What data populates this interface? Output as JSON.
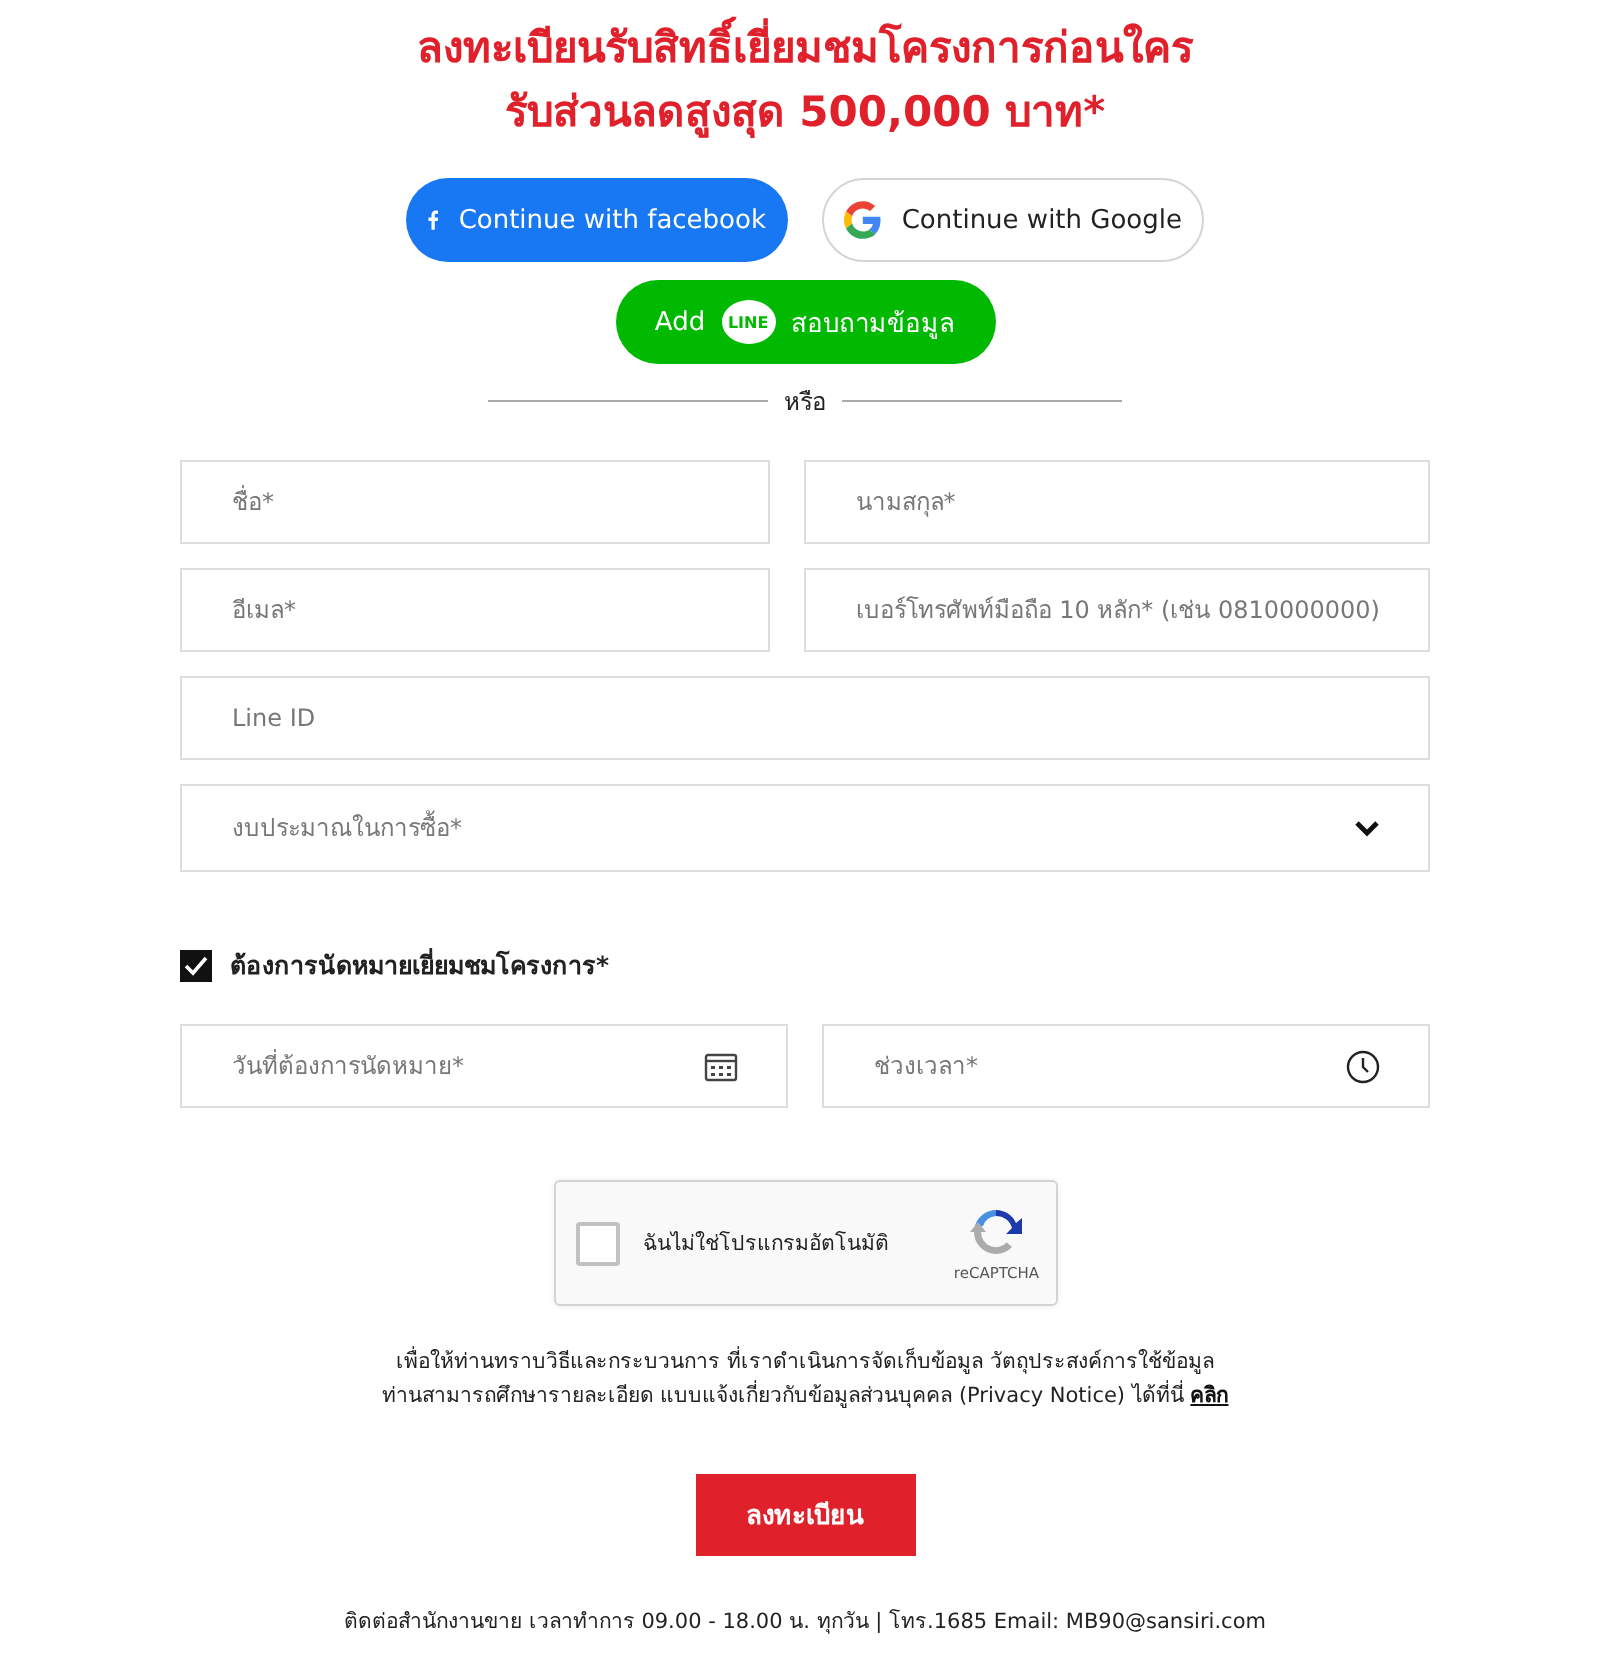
{
  "heading": {
    "line_1": "ลงทะเบียนรับสิทธิ์เยี่ยมชมโครงการก่อนใคร",
    "line_2": "รับส่วนลดสูงสุด 500,000 บาท*"
  },
  "social_buttons": [
    {
      "kind": "facebook",
      "label": "Continue with facebook"
    },
    {
      "kind": "google",
      "label": "Continue with Google"
    },
    {
      "kind": "line",
      "label_before": "Add",
      "logo_text": "LINE",
      "label": "สอบถามข้อมูล"
    }
  ],
  "divider": "หรือ",
  "fields": [
    {
      "kind": "text",
      "placeholder": "ชื่อ*"
    },
    {
      "kind": "text",
      "placeholder": "นามสกุล*"
    },
    {
      "kind": "text",
      "placeholder": "อีเมล*"
    },
    {
      "kind": "text",
      "placeholder": "เบอร์โทรศัพท์มือถือ 10 หลัก* (เช่น 0810000000)"
    },
    {
      "kind": "wide",
      "placeholder": "Line ID"
    },
    {
      "kind": "select",
      "placeholder": "งบประมาณในการซื้อ*"
    }
  ],
  "appointment": {
    "label": "ต้องการนัดหมายเยี่ยมชมโครงการ*",
    "checked": true
  },
  "appointment_fields": [
    {
      "kind": "date",
      "placeholder": "วันที่ต้องการนัดหมาย*"
    },
    {
      "kind": "time",
      "placeholder": "ช่วงเวลา*"
    }
  ],
  "captcha": {
    "label": "ฉันไม่ใช่โปรแกรมอัตโนมัติ",
    "checked": false,
    "brand": "reCAPTCHA"
  },
  "privacy": {
    "line_1": "เพื่อให้ท่านทราบวิธีและกระบวนการ ที่เราดำเนินการจัดเก็บข้อมูล วัตถุประสงค์การใช้ข้อมูล",
    "line_2": "ท่านสามารถศึกษารายละเอียด แบบแจ้งเกี่ยวกับข้อมูลส่วนบุคคล (Privacy Notice) ได้ที่นี่",
    "link": "คลิก"
  },
  "submit": "ลงทะเบียน",
  "footer": "ติดต่อสำนักงานขาย เวลาทำการ 09.00 - 18.00 น. ทุกวัน | โทร.1685 Email: MB90@sansiri.com"
}
